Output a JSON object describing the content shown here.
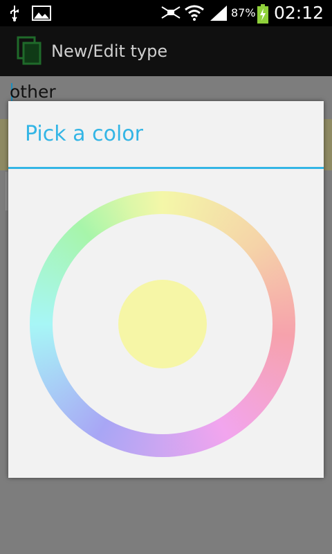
{
  "status_bar": {
    "battery_percent": "87%",
    "time": "02:12",
    "icons": [
      "usb-icon",
      "gallery-icon",
      "mute-icon",
      "wifi-icon",
      "signal-icon",
      "battery-charging-icon"
    ]
  },
  "action_bar": {
    "title": "New/Edit type",
    "icon": "app-icon"
  },
  "background_form": {
    "type_value": "other"
  },
  "dialog": {
    "title": "Pick a color",
    "accent_color": "#33b5e5",
    "selected_color": "#f6f6a6"
  }
}
